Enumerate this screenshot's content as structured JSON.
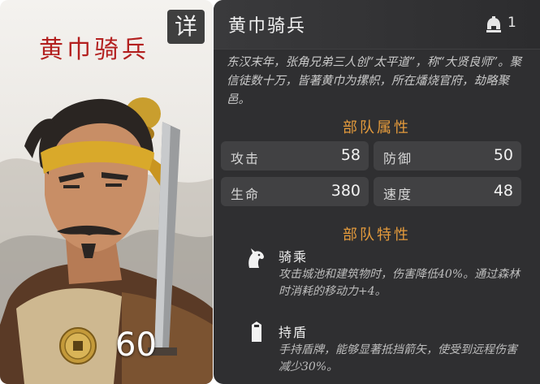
{
  "card": {
    "title": "黄巾骑兵",
    "detail_badge": "详",
    "cost": "60",
    "coin_icon": "coin-icon",
    "portrait": "yellow-turban-rider-portrait"
  },
  "panel": {
    "unit_name": "黄巾骑兵",
    "tier": "1",
    "tier_icon": "helmet-icon",
    "description": "东汉末年，张角兄弟三人创“太平道”，称“大贤良师”。聚信徒数十万，皆著黄巾为摞帜，所在燔烧官府，劫略聚邑。",
    "stats_title": "部队属性",
    "stats": [
      {
        "label": "攻击",
        "value": "58"
      },
      {
        "label": "防御",
        "value": "50"
      },
      {
        "label": "生命",
        "value": "380"
      },
      {
        "label": "速度",
        "value": "48"
      }
    ],
    "traits_title": "部队特性",
    "traits": [
      {
        "icon": "horse-icon",
        "name": "骑乘",
        "desc": "攻击城池和建筑物时，伤害降低40%。通过森林时消耗的移动力+4。"
      },
      {
        "icon": "shield-icon",
        "name": "持盾",
        "desc": "手持盾牌，能够显著抵挡箭矢，使受到远程伤害减少30%。"
      }
    ]
  },
  "colors": {
    "card_title": "#b3201f",
    "section_title": "#e39a3c",
    "panel_bg": "#2f2f31",
    "stat_bg": "#414143"
  }
}
